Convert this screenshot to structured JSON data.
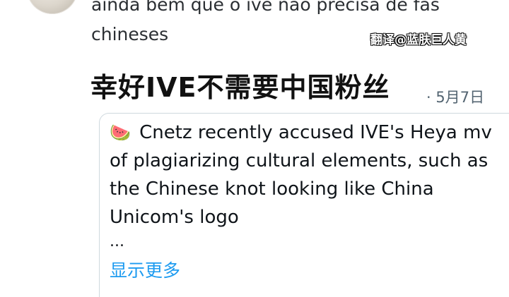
{
  "reply": {
    "quoted_text": "ainda bem que o ive não precisa de fãs chineses"
  },
  "watermark": "翻译@蓝肤巨人黄",
  "translation_heading": "幸好IVE不需要中国粉丝",
  "tweet": {
    "separator": "·",
    "date": "5月7日",
    "body_emoji": "🍉",
    "body": "Cnetz recently accused IVE's Heya mv of plagiarizing cultural elements, such as the Chinese knot looking like China Unicom's logo",
    "ellipsis": "...",
    "show_more": "显示更多"
  },
  "colors": {
    "link": "#1d9bf0",
    "meta": "#536471",
    "border": "#cfd9de"
  }
}
